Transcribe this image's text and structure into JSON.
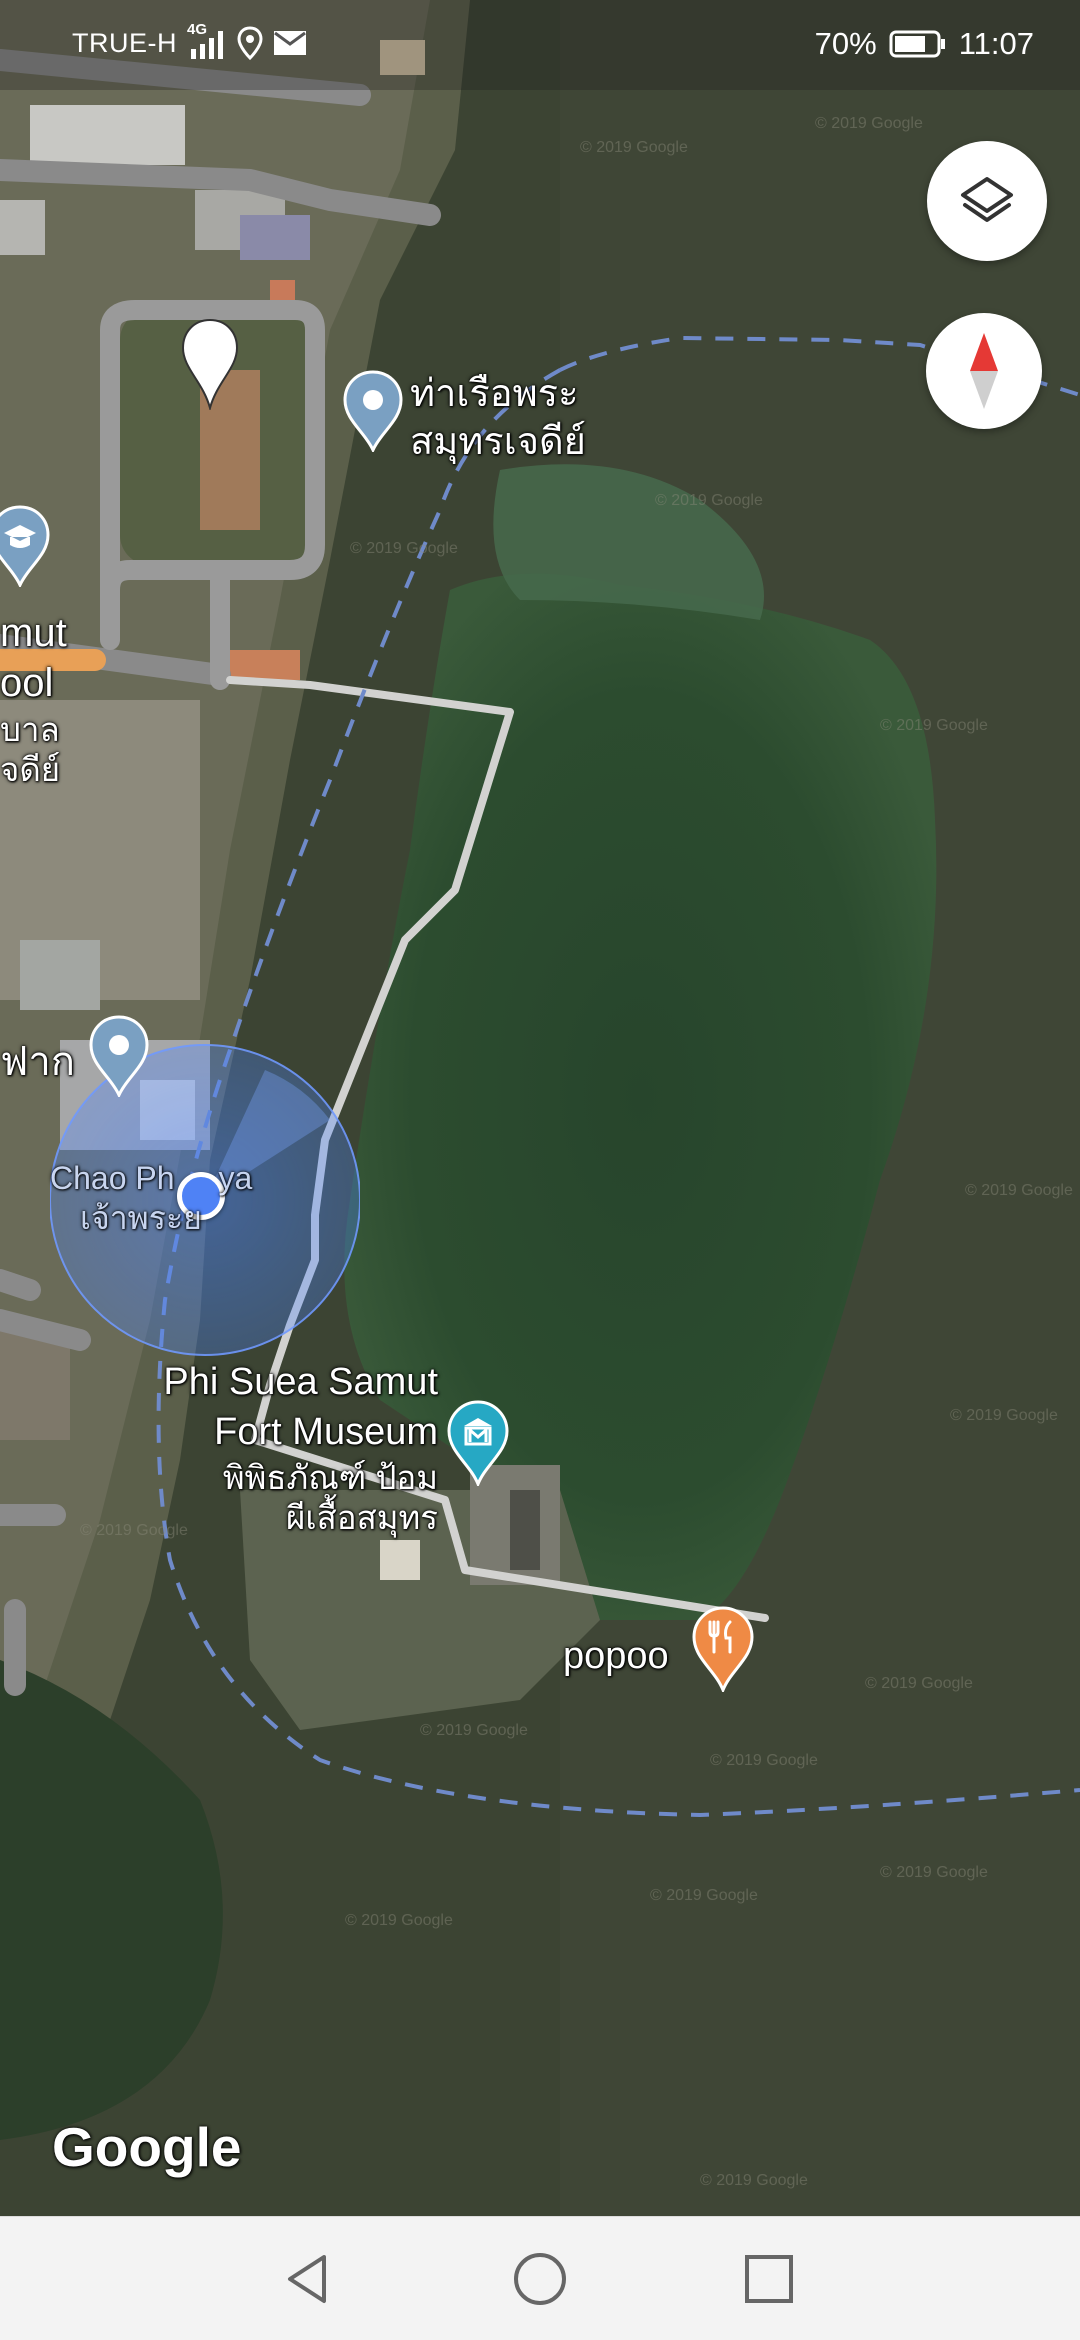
{
  "status_bar": {
    "carrier": "TRUE-H",
    "network": "4G",
    "battery": "70%",
    "time": "11:07"
  },
  "map": {
    "places": {
      "pier": {
        "line1": "ท่าเรือพระ",
        "line2": "สมุทรเจดีย์"
      },
      "school": {
        "line1": "mut",
        "line2": "ool",
        "line3": "บาล",
        "line4": "จดีย์"
      },
      "left_label": "ฟาก",
      "chao_phraya": {
        "line1": "Chao Ph",
        "line1b": "ya",
        "line2": "เจ้าพระย"
      },
      "museum": {
        "line1": "Phi Suea Samut",
        "line2": "Fort Museum",
        "line3": "พิพิธภัณฑ์ ป้อม",
        "line4": "ผีเสื้อสมุทร"
      },
      "restaurant": "popoo"
    },
    "attribution": "Google",
    "watermark": "© 2019 Google"
  },
  "controls": {
    "layers_icon": "layers-icon",
    "compass_icon": "compass-icon"
  },
  "nav": {
    "back": "back-icon",
    "home": "home-icon",
    "recents": "recents-icon"
  }
}
